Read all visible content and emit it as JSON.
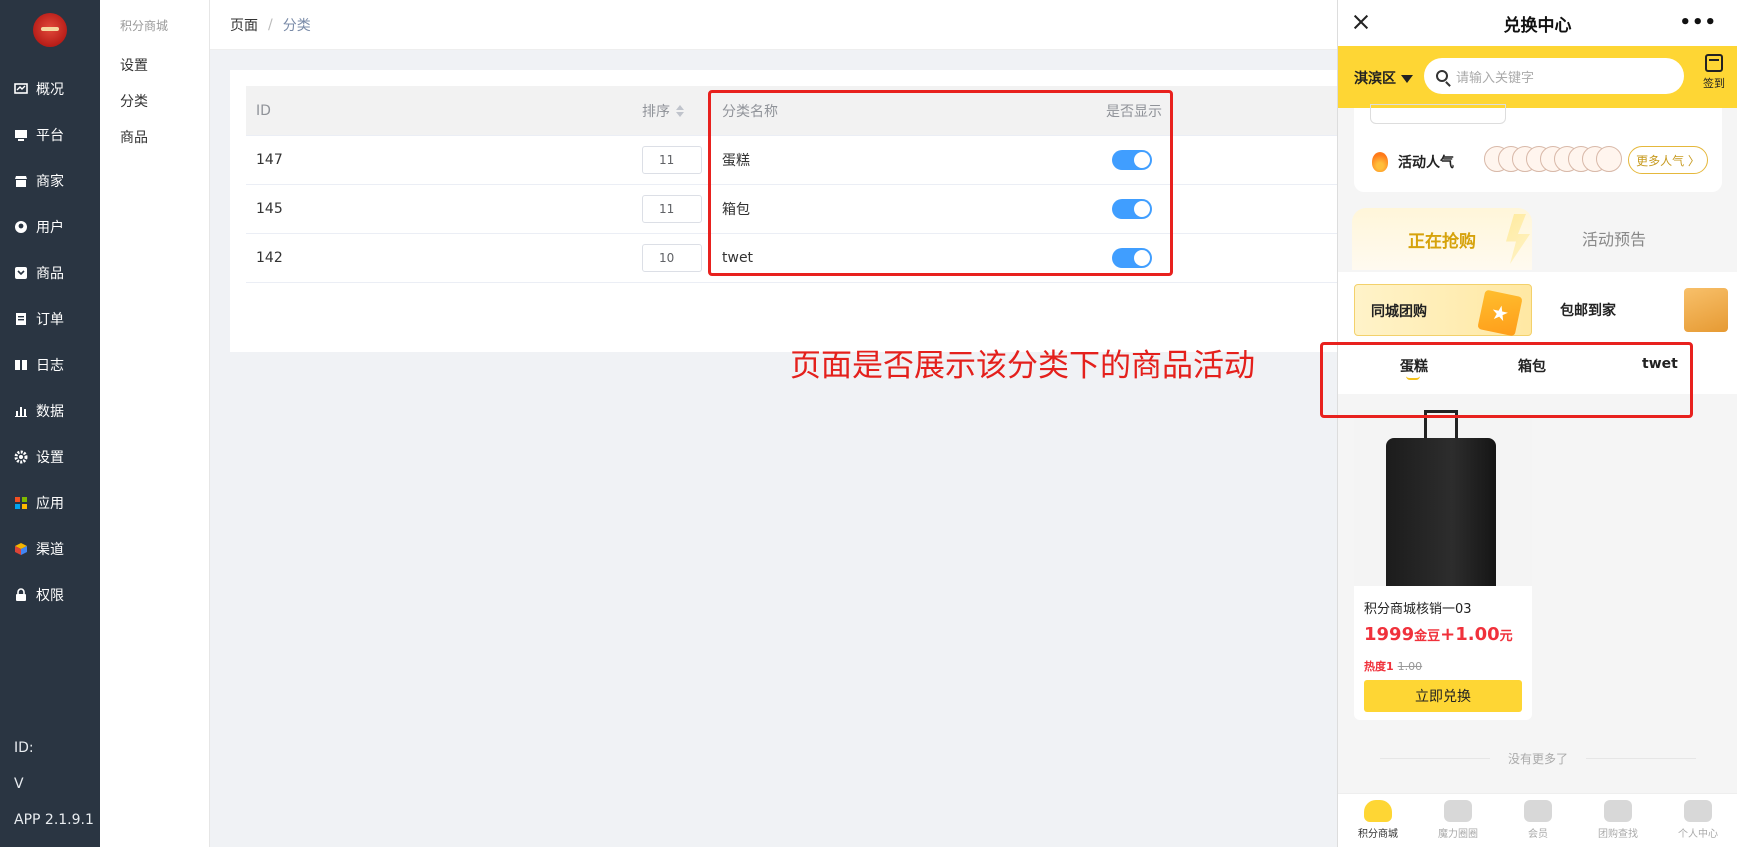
{
  "nav": {
    "items": [
      {
        "label": "概况",
        "icon": "monitor-chart-icon"
      },
      {
        "label": "平台",
        "icon": "desktop-icon"
      },
      {
        "label": "商家",
        "icon": "store-icon"
      },
      {
        "label": "用户",
        "icon": "user-icon"
      },
      {
        "label": "商品",
        "icon": "product-icon"
      },
      {
        "label": "订单",
        "icon": "order-icon"
      },
      {
        "label": "日志",
        "icon": "log-book-icon"
      },
      {
        "label": "数据",
        "icon": "bar-chart-icon"
      },
      {
        "label": "设置",
        "icon": "gear-icon"
      },
      {
        "label": "应用",
        "icon": "app-grid-icon"
      },
      {
        "label": "渠道",
        "icon": "cube-icon"
      },
      {
        "label": "权限",
        "icon": "lock-icon"
      }
    ],
    "footer": {
      "id": "ID:",
      "v": "V",
      "app": "APP 2.1.9.1"
    }
  },
  "subnav": {
    "header": "积分商城",
    "items": [
      "设置",
      "分类",
      "商品"
    ]
  },
  "breadcrumb": {
    "root": "页面",
    "sep": "/",
    "current": "分类"
  },
  "table": {
    "headers": {
      "id": "ID",
      "sort": "排序",
      "name": "分类名称",
      "show": "是否显示"
    },
    "rows": [
      {
        "id": "147",
        "sort": "11",
        "name": "蛋糕",
        "show": true
      },
      {
        "id": "145",
        "sort": "11",
        "name": "箱包",
        "show": true
      },
      {
        "id": "142",
        "sort": "10",
        "name": "twet",
        "show": true
      }
    ]
  },
  "annotation": "页面是否展示该分类下的商品活动",
  "phone": {
    "title": "兑换中心",
    "location": "淇滨区",
    "search_placeholder": "请输入关键字",
    "signin": "签到",
    "hot_label": "活动人气",
    "more_hot": "更多人气 〉",
    "tab_active": "正在抢购",
    "tab_inactive": "活动预告",
    "sub_tab1": "同城团购",
    "sub_tab2": "包邮到家",
    "categories": [
      "蛋糕",
      "箱包",
      "twet"
    ],
    "goods": {
      "name": "积分商城核销一03",
      "price_points": "1999",
      "price_points_unit": "金豆",
      "price_cash": "+1.00",
      "price_cash_unit": "元",
      "heat": "热度1",
      "orig_price": "1.00",
      "buy": "立即兑换"
    },
    "no_more": "没有更多了",
    "tabbar": [
      "积分商城",
      "魔力圈圈",
      "会员",
      "团购查找",
      "个人中心"
    ],
    "colors": {
      "accent": "#fed634",
      "price": "#f0313b",
      "switch": "#409eff",
      "annotation": "#e4201c"
    }
  }
}
